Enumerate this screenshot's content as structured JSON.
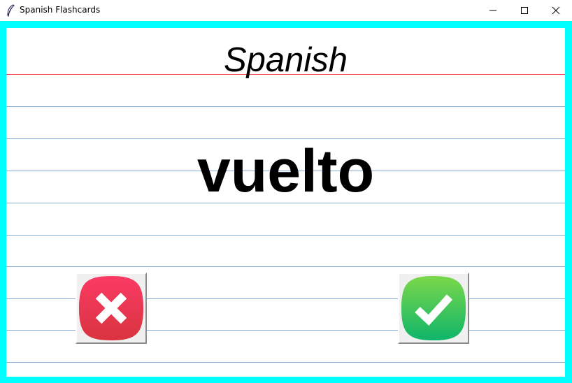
{
  "window": {
    "title": "Spanish Flashcards"
  },
  "card": {
    "language": "Spanish",
    "word": "vuelto"
  },
  "buttons": {
    "wrong_icon": "cross-icon",
    "right_icon": "check-icon"
  },
  "colors": {
    "frame": "#00ffff",
    "red_rule": "#f24a4a",
    "blue_rule": "#8aaed3",
    "wrong": "#e8324f",
    "right": "#3cc25a"
  }
}
